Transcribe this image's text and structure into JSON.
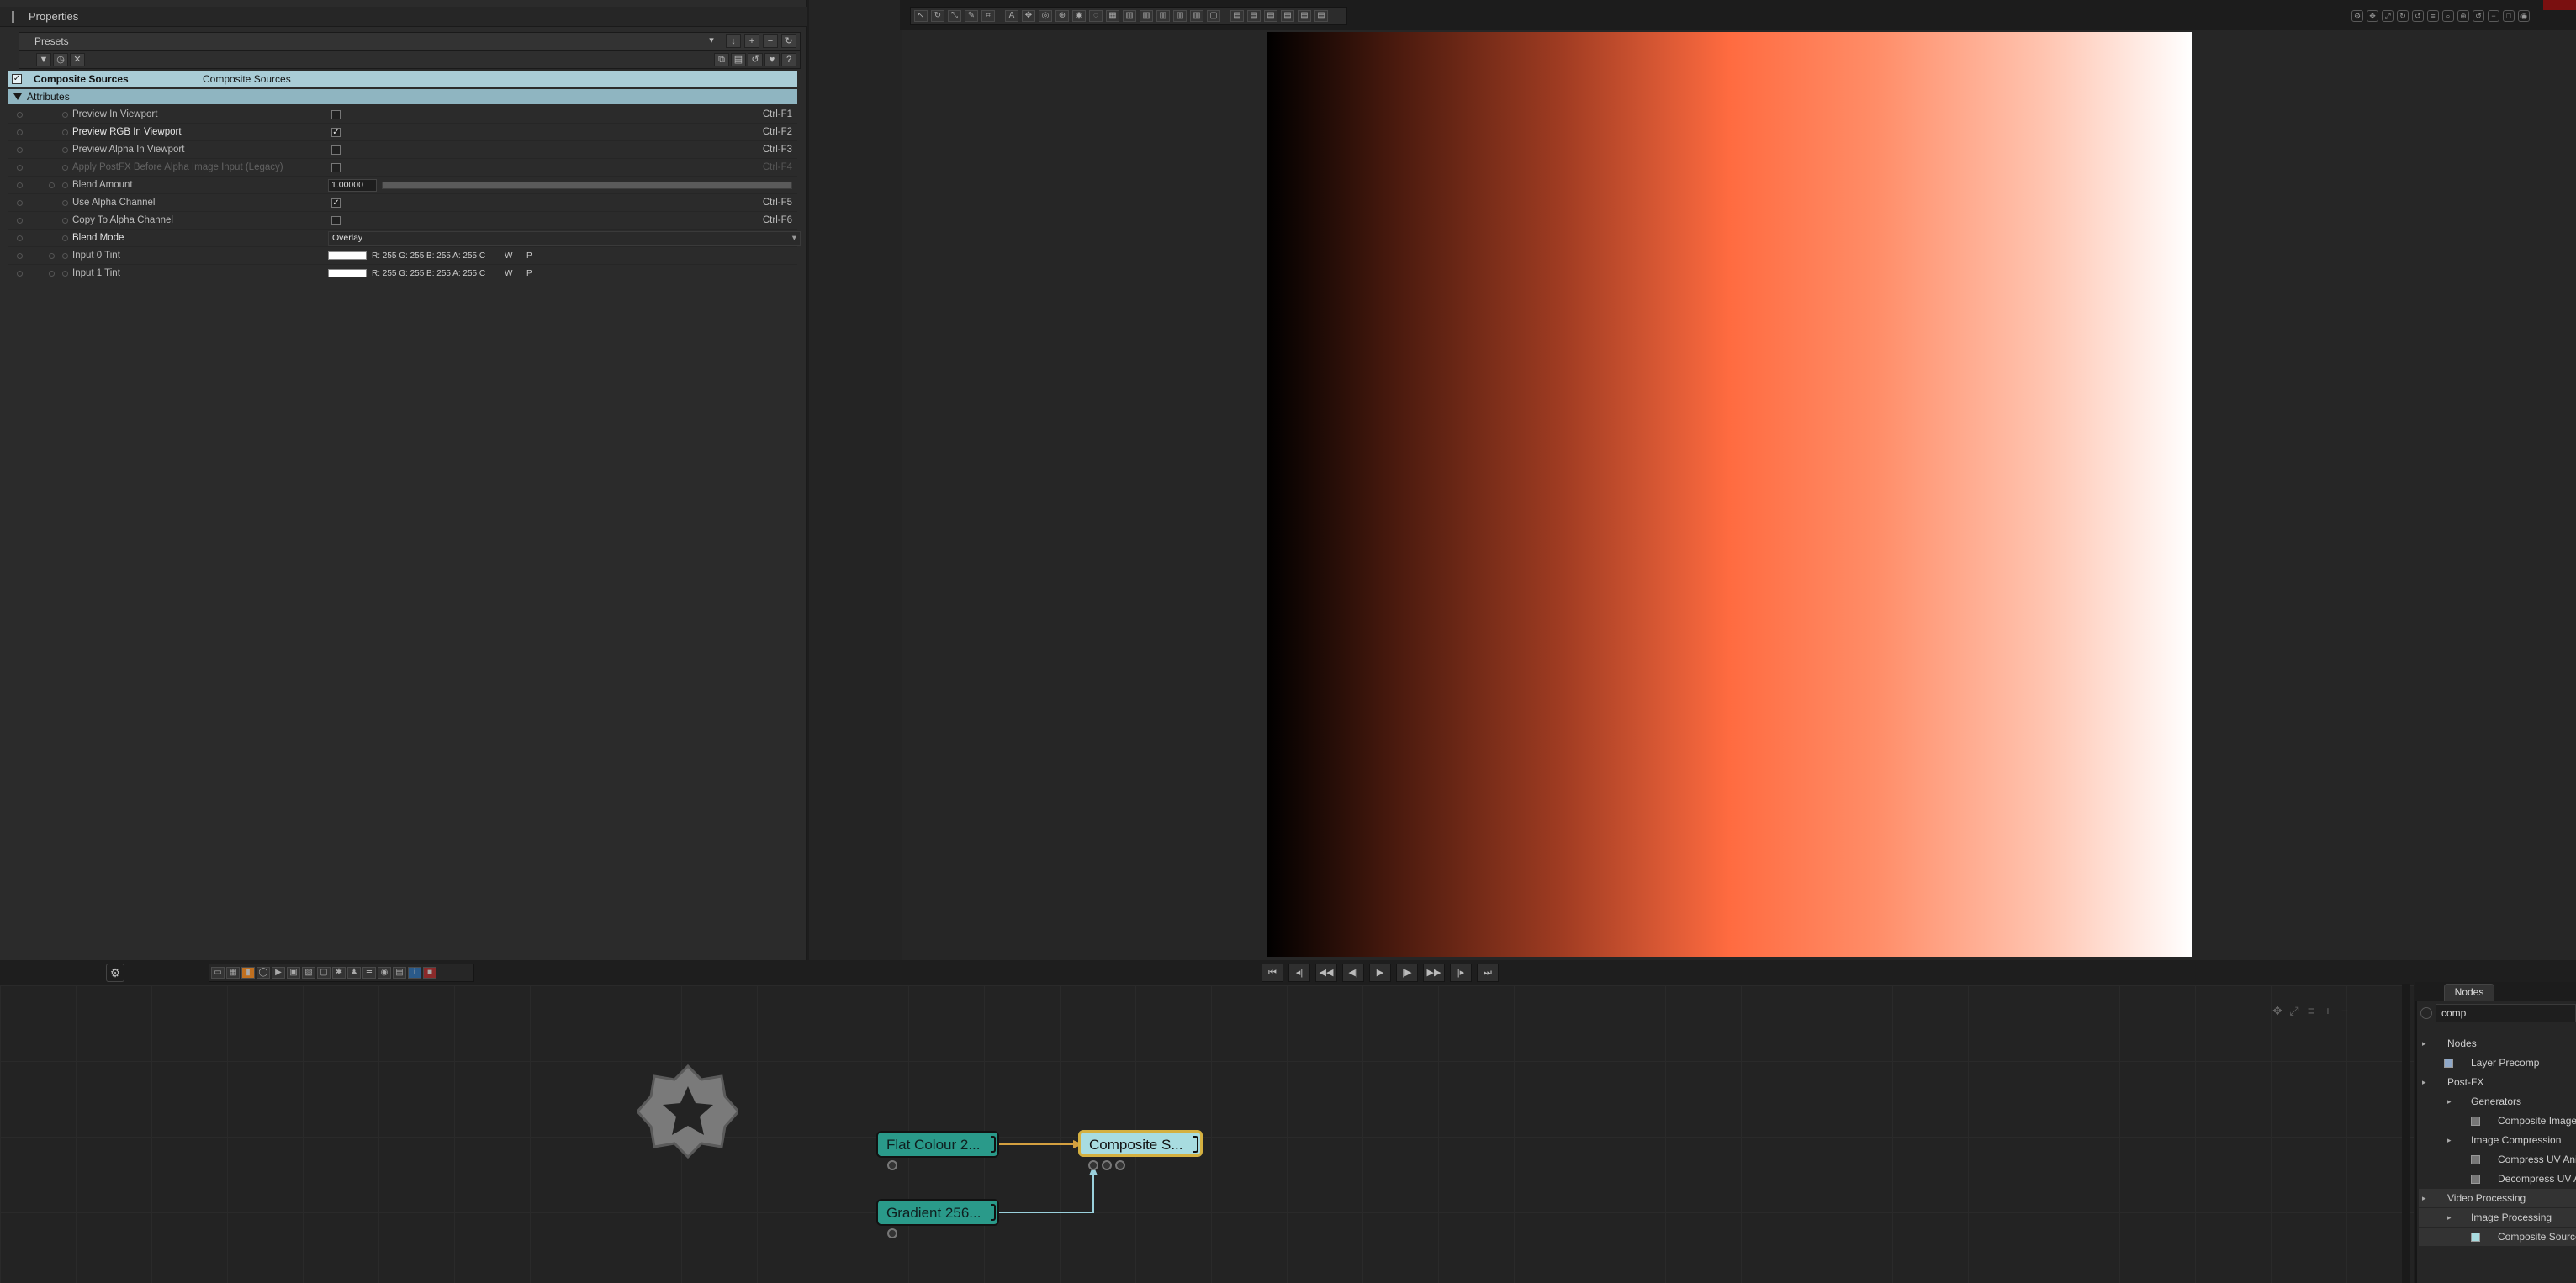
{
  "properties": {
    "panel_title": "Properties",
    "presets_label": "Presets",
    "node_name": "Composite Sources",
    "node_type": "Composite Sources",
    "attributes_label": "Attributes",
    "rows": [
      {
        "label": "Preview In Viewport",
        "checked": false,
        "shortcut": "Ctrl-F1"
      },
      {
        "label": "Preview RGB In Viewport",
        "checked": true,
        "shortcut": "Ctrl-F2"
      },
      {
        "label": "Preview Alpha In Viewport",
        "checked": false,
        "shortcut": "Ctrl-F3"
      },
      {
        "label": "Apply PostFX Before Alpha Image Input (Legacy)",
        "checked": false,
        "shortcut": "Ctrl-F4"
      },
      {
        "label": "Blend Amount",
        "value": "1.00000"
      },
      {
        "label": "Use Alpha Channel",
        "checked": true,
        "shortcut": "Ctrl-F5"
      },
      {
        "label": "Copy To Alpha Channel",
        "checked": false,
        "shortcut": "Ctrl-F6"
      },
      {
        "label": "Blend Mode",
        "value": "Overlay"
      },
      {
        "label": "Input 0 Tint",
        "value": "R: 255 G: 255 B: 255 A: 255 C",
        "w": "W",
        "p": "P"
      },
      {
        "label": "Input 1 Tint",
        "value": "R: 255 G: 255 B: 255 A: 255 C",
        "w": "W",
        "p": "P"
      }
    ],
    "blend_amount_level": 1.0
  },
  "viewport": {
    "gradient_colors": [
      "#000000",
      "#a03c22",
      "#ff6b40",
      "#ffffff"
    ]
  },
  "graph": {
    "nodes": [
      {
        "label": "Flat Colour 2...",
        "color": "#2a9a8a"
      },
      {
        "label": "Composite S...",
        "color": "#a8dce0"
      },
      {
        "label": "Gradient 256...",
        "color": "#2a9a8a"
      }
    ],
    "selected_border": "#d4b040",
    "link_color": "#9ad0dc",
    "link_color_2": "#d4a040"
  },
  "nodes_panel": {
    "tab_active": "Nodes",
    "search_value": "comp",
    "tree": [
      {
        "label": "Nodes",
        "depth": 0,
        "kind": "folder"
      },
      {
        "label": "Layer Precomp",
        "depth": 1,
        "kind": "item"
      },
      {
        "label": "Post-FX",
        "depth": 0,
        "kind": "folder"
      },
      {
        "label": "Generators",
        "depth": 1,
        "kind": "folder"
      },
      {
        "label": "Composite Image",
        "depth": 2,
        "kind": "item"
      },
      {
        "label": "Image Compression",
        "depth": 1,
        "kind": "folder"
      },
      {
        "label": "Compress UV Ani",
        "depth": 2,
        "kind": "item"
      },
      {
        "label": "Decompress UV A",
        "depth": 2,
        "kind": "item"
      },
      {
        "label": "Video Processing",
        "depth": 0,
        "kind": "folder"
      },
      {
        "label": "Image Processing",
        "depth": 1,
        "kind": "folder"
      },
      {
        "label": "Composite Source",
        "depth": 2,
        "kind": "item",
        "selected": true
      }
    ]
  },
  "icons": [
    "settings-icon",
    "filter-icon",
    "search-icon",
    "close-icon",
    "help-icon",
    "play-icon",
    "star-gear-icon"
  ]
}
